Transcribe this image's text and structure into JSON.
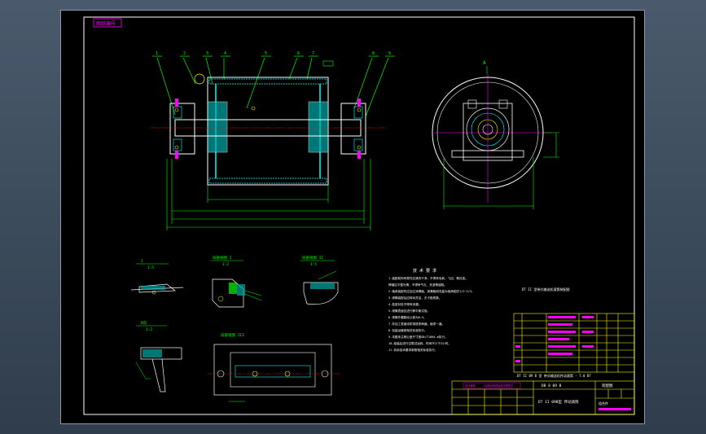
{
  "drawing": {
    "stamp": "图纸编号",
    "numbers": {
      "n1": "1",
      "n2": "2",
      "n3": "3",
      "n4": "4",
      "n5": "5",
      "n6": "6",
      "n7": "7",
      "n8": "8",
      "n9": "9"
    },
    "side_label": "A",
    "views": {
      "detail1": "I",
      "detail2": "局部视图 I",
      "detail3": "局部视图 II",
      "detail4": "局部视图 III",
      "detail5": "B向",
      "scale_a": "1:5",
      "scale_b": "1:2",
      "scale_c": "1:5"
    },
    "notes": {
      "title": "技 术 要 求",
      "lines": [
        "1.装配前所有零件应清洗干净，不得有毛刺、飞边、氧化皮。",
        "  焊缝应平整光滑，不得有气孔、夹渣等缺陷。",
        "2.轴承装配时应加注润滑脂，润滑脂填充量为轴承腔的1/2~2/3。",
        "3.滚筒装配后应转动灵活，无卡阻现象。",
        "4.各密封处不得有渗漏。",
        "5.滚筒表面应进行静平衡试验。",
        "6.滚筒外圆跳动公差为0.5。",
        "7.非加工表面涂防锈底漆两遍，面漆一遍。",
        "8.包装运输按相关标准执行。",
        "9.本图未注明公差尺寸按GB/T1804-m执行。",
        "10.组装后进行空载试运转，时间不少于2小时。",
        "11.其余技术要求参照相关标准执行。"
      ]
    },
    "caption": "DT II 型带式输送机滚筒装配图",
    "parts_footer": "DT II 09 B 型 带式输送机传动滚筒 - 7.0 B7",
    "title_block": {
      "code": "DB 8 09 B",
      "name": "装配图",
      "subtitle": "DT II 09B型 传动滚筒",
      "material": "组合件",
      "stamp_lines": [
        "设计审核",
        "标准化审查批准日期签字"
      ]
    }
  }
}
